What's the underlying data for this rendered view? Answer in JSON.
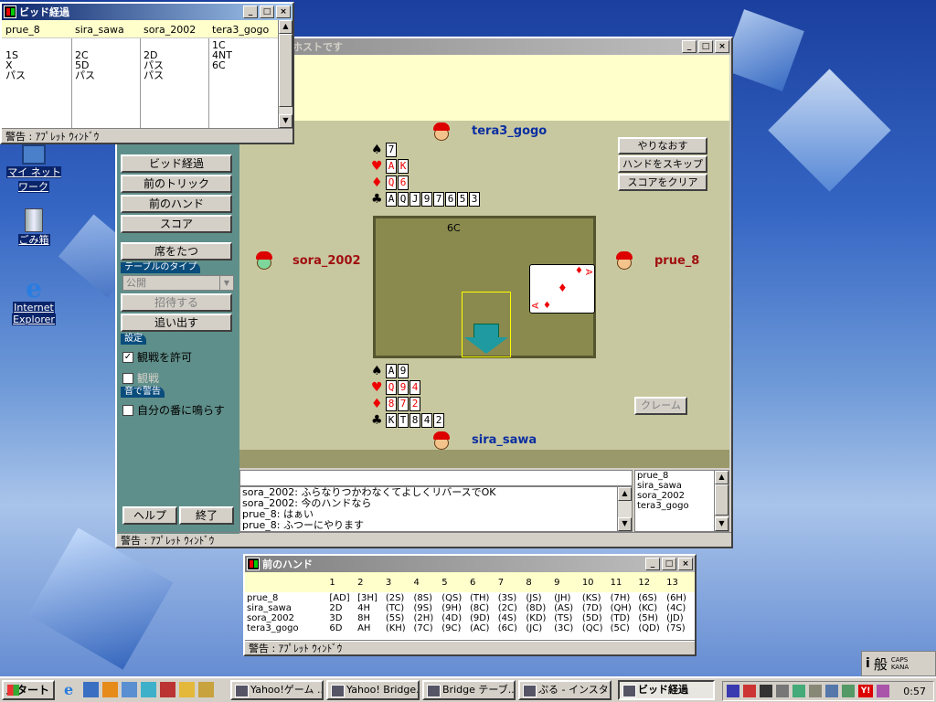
{
  "desktop": {
    "icons": [
      {
        "label": "マイ ネットワーク",
        "icon": "network-icon"
      },
      {
        "label": "ごみ箱",
        "icon": "recycle-bin-icon"
      },
      {
        "label": "Internet",
        "label2": "Explorer",
        "icon": "ie-icon"
      }
    ]
  },
  "main_window": {
    "title": "ホストです",
    "top_player": "tera3_gogo",
    "left_player": "sora_2002",
    "right_player": "prue_8",
    "bottom_player": "sira_sawa",
    "contract": "6C",
    "north_hand": {
      "spades": [
        "7"
      ],
      "hearts": [
        "A",
        "K"
      ],
      "diamonds": [
        "Q",
        "6"
      ],
      "clubs": [
        "A",
        "Q",
        "J",
        "9",
        "7",
        "6",
        "5",
        "3"
      ]
    },
    "south_hand": {
      "spades": [
        "A",
        "9"
      ],
      "hearts": [
        "Q",
        "9",
        "4"
      ],
      "diamonds": [
        "8",
        "7",
        "2"
      ],
      "clubs": [
        "K",
        "T",
        "8",
        "4",
        "2"
      ]
    },
    "played_card": {
      "rank": "A",
      "suit": "diamonds"
    },
    "buttons": {
      "redo": "やりなおす",
      "skip_hand": "ハンドをスキップ",
      "clear_score": "スコアをクリア",
      "claim": "クレーム"
    },
    "sidebar": {
      "bid_history": "ビッド経過",
      "prev_trick": "前のトリック",
      "prev_hand": "前のハンド",
      "score": "スコア",
      "leave_seat": "席をたつ",
      "table_type_label": "テーブルのタイプ",
      "table_type_value": "公開",
      "invite": "招待する",
      "kick": "追い出す",
      "settings_label": "設定",
      "allow_watch": "観戦を許可",
      "rated": "観戦",
      "sound_label": "音で警告",
      "ring_on_turn": "自分の番に鳴らす",
      "help": "ヘルプ",
      "exit": "終了"
    },
    "chat_lines": [
      "sora_2002: ふらなりつかわなくてよしくリバースでOK",
      "sora_2002: 今のハンドなら",
      "prue_8: はぁい",
      "prue_8: ふつーにやります"
    ],
    "players_list": [
      "prue_8",
      "sira_sawa",
      "sora_2002",
      "tera3_gogo"
    ],
    "status": "警告 : ｱﾌﾟﾚｯﾄ ｳｨﾝﾄﾞｳ"
  },
  "bid_window": {
    "title": "ビッド経過",
    "columns": [
      "prue_8",
      "sira_sawa",
      "sora_2002",
      "tera3_gogo"
    ],
    "bids": [
      [
        "",
        "",
        "",
        "1C"
      ],
      [
        "1S",
        "2C",
        "2D",
        "4NT"
      ],
      [
        "X",
        "5D",
        "パス",
        "6C"
      ],
      [
        "パス",
        "パス",
        "パス",
        ""
      ]
    ],
    "status": "警告 : ｱﾌﾟﾚｯﾄ ｳｨﾝﾄﾞｳ"
  },
  "prev_hand_window": {
    "title": "前のハンド",
    "tricks": [
      "1",
      "2",
      "3",
      "4",
      "5",
      "6",
      "7",
      "8",
      "9",
      "10",
      "11",
      "12",
      "13"
    ],
    "rows": [
      {
        "name": "prue_8",
        "cards": [
          "[AD]",
          "[3H]",
          "(2S)",
          "(8S)",
          "(QS)",
          "(TH)",
          "(3S)",
          "(JS)",
          "(JH)",
          "(KS)",
          "(7H)",
          "(6S)",
          "(6H)"
        ]
      },
      {
        "name": "sira_sawa",
        "cards": [
          "2D",
          "4H",
          "(TC)",
          "(9S)",
          "(9H)",
          "(8C)",
          "(2C)",
          "(8D)",
          "(AS)",
          "(7D)",
          "(QH)",
          "(KC)",
          "(4C)"
        ]
      },
      {
        "name": "sora_2002",
        "cards": [
          "3D",
          "8H",
          "(5S)",
          "(2H)",
          "(4D)",
          "(9D)",
          "(4S)",
          "(KD)",
          "(TS)",
          "(5D)",
          "(TD)",
          "(5H)",
          "(JD)"
        ]
      },
      {
        "name": "tera3_gogo",
        "cards": [
          "6D",
          "AH",
          "(KH)",
          "(7C)",
          "(9C)",
          "(AC)",
          "(6C)",
          "(JC)",
          "(3C)",
          "(QC)",
          "(5C)",
          "(QD)",
          "(7S)"
        ]
      }
    ],
    "status": "警告 : ｱﾌﾟﾚｯﾄ ｳｨﾝﾄﾞｳ"
  },
  "ime": {
    "mode": "般",
    "caps": "CAPS",
    "kana": "KANA"
  },
  "taskbar": {
    "start": "スタート",
    "tasks": [
      "Yahoo!ゲーム ...",
      "Yahoo! Bridge...",
      "Bridge テーブ...",
      "ぷる - インスタ...",
      "ビッド経過"
    ],
    "clock": "0:57"
  }
}
